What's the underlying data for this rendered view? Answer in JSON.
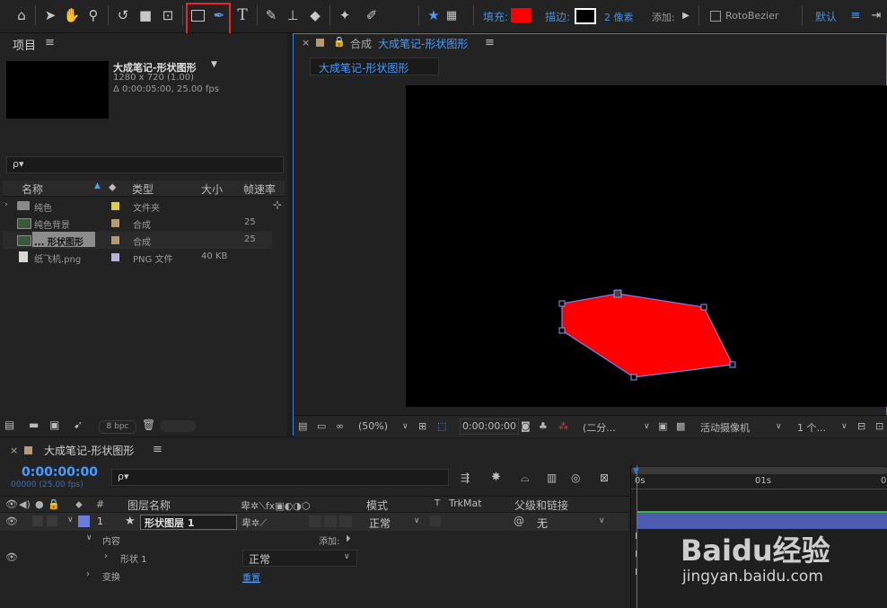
{
  "toolbar": {
    "fill_label": "填充:",
    "fill_color": "#ff0000",
    "stroke_label": "描边:",
    "stroke_width": "2 像素",
    "add_label": "添加:",
    "rotobezier_label": "RotoBezier",
    "default_label": "默认",
    "icons": [
      "home-icon",
      "selection-arrow-icon",
      "hand-icon",
      "zoom-icon",
      "rotate-icon",
      "camera-icon",
      "pan-behind-icon",
      "rectangle-tool-icon",
      "pen-tool-icon",
      "type-tool-icon",
      "brush-icon",
      "clone-stamp-icon",
      "eraser-icon",
      "roto-brush-icon",
      "puppet-pin-icon"
    ]
  },
  "project": {
    "panel_title": "项目",
    "comp_name": "大成笔记-形状图形",
    "comp_size": "1280 x 720 (1.00)",
    "comp_duration": "Δ 0:00:05:00, 25.00 fps",
    "search_placeholder": "ρ▾",
    "columns": {
      "name": "名称",
      "type": "类型",
      "size": "大小",
      "fps": "帧速率"
    },
    "items": [
      {
        "name": "纯色",
        "type": "文件夹",
        "size": "",
        "fps": "",
        "swatch": "#e2c84a",
        "kind": "folder"
      },
      {
        "name": "纯色背景",
        "type": "合成",
        "size": "",
        "fps": "25",
        "swatch": "#b59b73",
        "kind": "comp"
      },
      {
        "name": "... 形状图形",
        "type": "合成",
        "size": "",
        "fps": "25",
        "swatch": "#b59b73",
        "kind": "comp"
      },
      {
        "name": "纸飞机.png",
        "type": "PNG 文件",
        "size": "40 KB",
        "fps": "",
        "swatch": "#b8b2d6",
        "kind": "png"
      }
    ],
    "bpc": "8 bpc"
  },
  "viewer": {
    "tab_prefix": "合成",
    "tab_name": "大成笔记-形状图形",
    "subtab": "大成笔记-形状图形",
    "zoom": "(50%)",
    "timecode": "0:00:00:00",
    "resolution": "(二分...",
    "camera": "活动摄像机",
    "views": "1 个...",
    "shape_fill": "#ff0000"
  },
  "timeline": {
    "comp_tab": "大成笔记-形状图形",
    "timecode": "0:00:00:00",
    "frame_info": "00000 (25.00 fps)",
    "search_placeholder": "ρ▾",
    "col_layer_name": "图层名称",
    "col_mode": "模式",
    "col_t": "T",
    "col_trkmat": "TrkMat",
    "col_parent": "父级和链接",
    "ruler": [
      "0s",
      "01s",
      "0"
    ],
    "layer": {
      "index": "1",
      "name": "形状图层 1",
      "mode": "正常",
      "parent": "无",
      "label_color": "#6b7de0"
    },
    "contents_label": "内容",
    "add_label": "添加:",
    "shape_label": "形状 1",
    "shape_mode": "正常",
    "transform_label": "变换",
    "reset_label": "重置"
  },
  "watermark": {
    "text": "Baidu经验",
    "url": "jingyan.baidu.com"
  }
}
